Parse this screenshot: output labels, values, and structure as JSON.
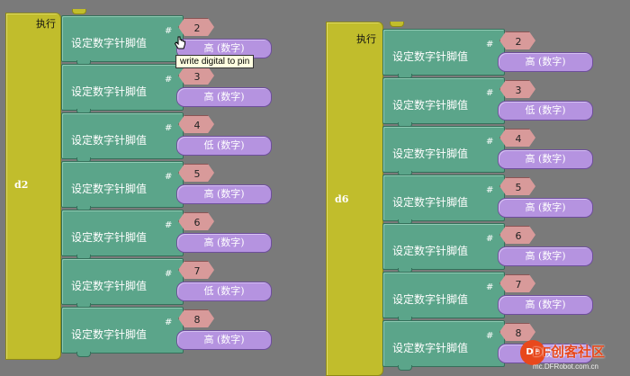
{
  "procedures": [
    {
      "name": "d2",
      "exec_label": "执行",
      "blocks": [
        {
          "label": "设定数字针脚值",
          "hash": "#",
          "pin": "2",
          "value": "高 (数字)"
        },
        {
          "label": "设定数字针脚值",
          "hash": "#",
          "pin": "3",
          "value": "高 (数字)"
        },
        {
          "label": "设定数字针脚值",
          "hash": "#",
          "pin": "4",
          "value": "低 (数字)"
        },
        {
          "label": "设定数字针脚值",
          "hash": "#",
          "pin": "5",
          "value": "高 (数字)"
        },
        {
          "label": "设定数字针脚值",
          "hash": "#",
          "pin": "6",
          "value": "高 (数字)"
        },
        {
          "label": "设定数字针脚值",
          "hash": "#",
          "pin": "7",
          "value": "低 (数字)"
        },
        {
          "label": "设定数字针脚值",
          "hash": "#",
          "pin": "8",
          "value": "高 (数字)"
        }
      ]
    },
    {
      "name": "d6",
      "exec_label": "执行",
      "blocks": [
        {
          "label": "设定数字针脚值",
          "hash": "#",
          "pin": "2",
          "value": "高 (数字)"
        },
        {
          "label": "设定数字针脚值",
          "hash": "#",
          "pin": "3",
          "value": "低 (数字)"
        },
        {
          "label": "设定数字针脚值",
          "hash": "#",
          "pin": "4",
          "value": "高 (数字)"
        },
        {
          "label": "设定数字针脚值",
          "hash": "#",
          "pin": "5",
          "value": "高 (数字)"
        },
        {
          "label": "设定数字针脚值",
          "hash": "#",
          "pin": "6",
          "value": "高 (数字)"
        },
        {
          "label": "设定数字针脚值",
          "hash": "#",
          "pin": "7",
          "value": "高 (数字)"
        },
        {
          "label": "设定数字针脚值",
          "hash": "#",
          "pin": "8",
          "value": "高 (数字)"
        }
      ]
    }
  ],
  "tooltip": "write digital to pin",
  "watermark": {
    "text": "DF创客社区",
    "url": "mc.DFRobot.com.cn",
    "logo": "DF"
  },
  "colors": {
    "workspace": "#7a7a7a",
    "procedure": "#c1bd2c",
    "statement": "#5ba58a",
    "pin_number": "#d89a9a",
    "value": "#b593e0",
    "watermark": "#e8481c"
  }
}
